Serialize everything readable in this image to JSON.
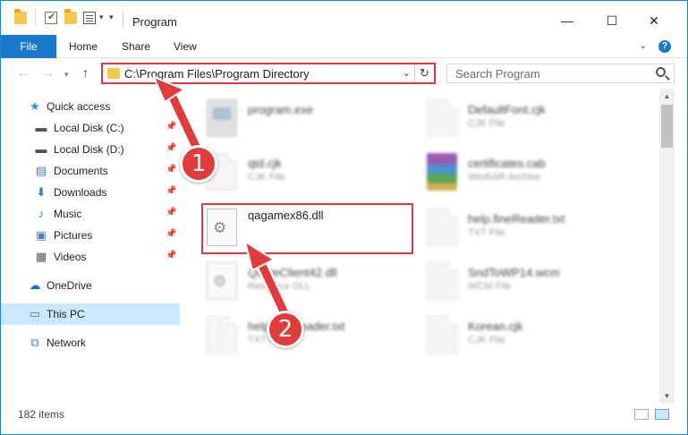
{
  "window": {
    "title": "Program",
    "controls": {
      "minimize": "—",
      "maximize": "☐",
      "close": "✕"
    }
  },
  "ribbon": {
    "tabs": [
      "File",
      "Home",
      "Share",
      "View"
    ],
    "help": "?"
  },
  "navigation": {
    "address_path": "C:\\Program Files\\Program Directory",
    "search_placeholder": "Search Program"
  },
  "sidebar": {
    "items": [
      {
        "label": "Quick access",
        "icon": "star-icon"
      },
      {
        "label": "Local Disk (C:)",
        "icon": "drive-icon"
      },
      {
        "label": "Local Disk (D:)",
        "icon": "drive-icon"
      },
      {
        "label": "Documents",
        "icon": "documents-icon"
      },
      {
        "label": "Downloads",
        "icon": "download-icon"
      },
      {
        "label": "Music",
        "icon": "music-icon"
      },
      {
        "label": "Pictures",
        "icon": "pictures-icon"
      },
      {
        "label": "Videos",
        "icon": "videos-icon"
      },
      {
        "label": "OneDrive",
        "icon": "cloud-icon"
      },
      {
        "label": "This PC",
        "icon": "computer-icon",
        "selected": true
      },
      {
        "label": "Network",
        "icon": "network-icon"
      }
    ]
  },
  "files": [
    {
      "name": "program.exe",
      "type": ""
    },
    {
      "name": "DefaultFont.cjk",
      "type": "CJK File"
    },
    {
      "name": "qtd.cjk",
      "type": "CJK File"
    },
    {
      "name": "certificates.cab",
      "type": "WinRAR Archive"
    },
    {
      "name": "qagamex86.dll",
      "type": ""
    },
    {
      "name": "help.fineReader.txt",
      "type": "TXT File"
    },
    {
      "name": "QuoteClient42.dll",
      "type": "Resource DLL"
    },
    {
      "name": "SndToWP14.wcm",
      "type": "WCM File"
    },
    {
      "name": "help.fineReader.txt",
      "type": "TXT File"
    },
    {
      "name": "Korean.cjk",
      "type": "CJK File"
    }
  ],
  "status": {
    "item_count": "182 items"
  },
  "callouts": {
    "step1": "1",
    "step2": "2"
  },
  "colors": {
    "accent": "#1979ca",
    "highlight": "#e23b3b",
    "selected": "#cce8ff"
  }
}
